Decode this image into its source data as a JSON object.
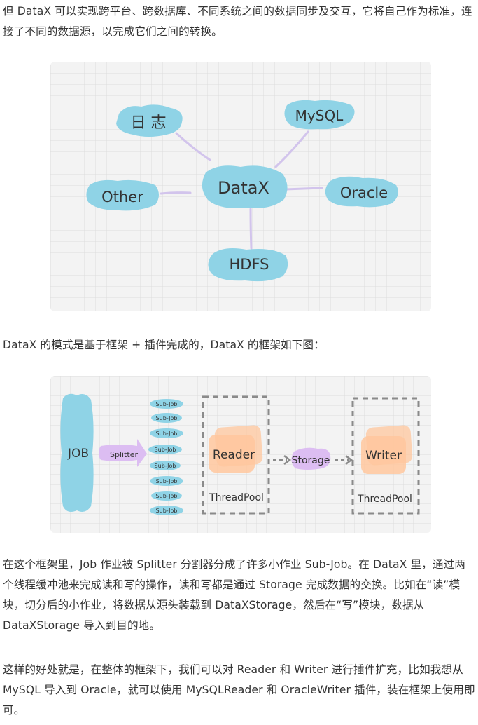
{
  "paragraphs": {
    "p1": "但 DataX 可以实现跨平台、跨数据库、不同系统之间的数据同步及交互，它将自己作为标准，连接了不同的数据源，以完成它们之间的转换。",
    "p2": "DataX 的模式是基于框架 + 插件完成的，DataX 的框架如下图：",
    "p3": "在这个框架里，Job 作业被 Splitter 分割器分成了许多小作业 Sub-Job。在 DataX 里，通过两个线程缓冲池来完成读和写的操作，读和写都是通过 Storage 完成数据的交换。比如在“读”模块，切分后的小作业，将数据从源头装载到 DataXStorage，然后在“写”模块，数据从 DataXStorage 导入到目的地。",
    "p4": "这样的好处就是，在整体的框架下，我们可以对 Reader 和 Writer 进行插件扩充，比如我想从 MySQL 导入到 Oracle，就可以使用 MySQLReader 和 OracleWriter 插件，装在框架上使用即可。"
  },
  "diagram1": {
    "center": "DataX",
    "nodes": {
      "log": "日 志",
      "mysql": "MySQL",
      "other": "Other",
      "oracle": "Oracle",
      "hdfs": "HDFS"
    }
  },
  "diagram2": {
    "job": "JOB",
    "splitter": "Splitter",
    "subjob": "Sub-Job",
    "reader": "Reader",
    "writer": "Writer",
    "storage": "Storage",
    "threadpool": "ThreadPool"
  },
  "colors": {
    "blob_blue": "#8fd3e6",
    "blob_purple": "#dcbdf2",
    "blob_orange": "#ffc79e",
    "line_purple": "#d2c4ec",
    "grid_bg": "#f3f3f3",
    "grid_line": "#dedede",
    "text": "#333333"
  }
}
